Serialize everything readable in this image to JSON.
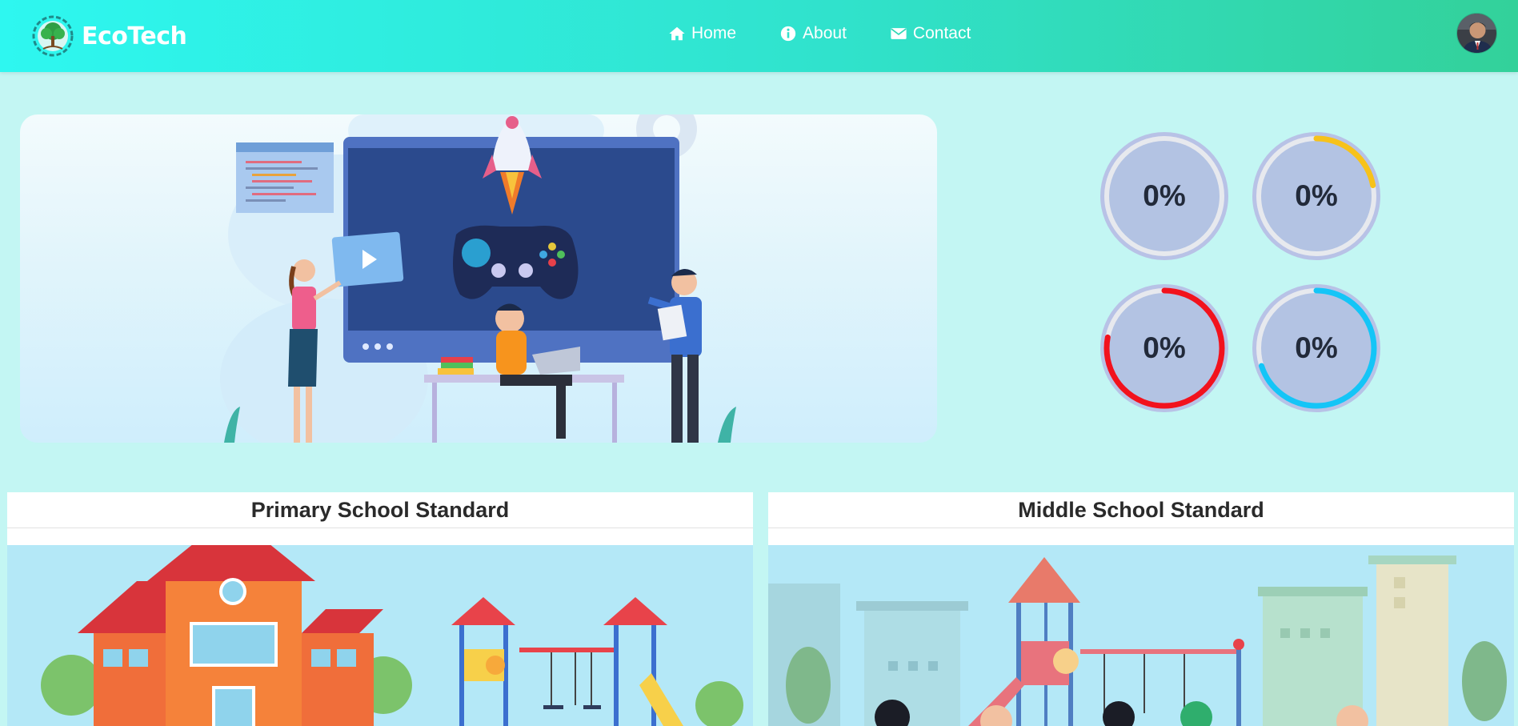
{
  "navbar": {
    "brand": "EcoTech",
    "links": [
      {
        "label": "Home",
        "icon": "home-icon"
      },
      {
        "label": "About",
        "icon": "info-icon"
      },
      {
        "label": "Contact",
        "icon": "envelope-icon"
      }
    ],
    "colors": {
      "gradient_start": "#2ef7f0",
      "gradient_end": "#33d19a"
    }
  },
  "progress": [
    {
      "label": "0%",
      "color": "#d0d6e6",
      "fill_fraction": 0.0
    },
    {
      "label": "0%",
      "color": "#f7c21a",
      "fill_fraction": 0.22
    },
    {
      "label": "0%",
      "color": "#f2121d",
      "fill_fraction": 0.78
    },
    {
      "label": "0%",
      "color": "#14c5f7",
      "fill_fraction": 0.7
    }
  ],
  "cards": [
    {
      "title": "Primary School Standard"
    },
    {
      "title": "Middle School Standard"
    }
  ]
}
